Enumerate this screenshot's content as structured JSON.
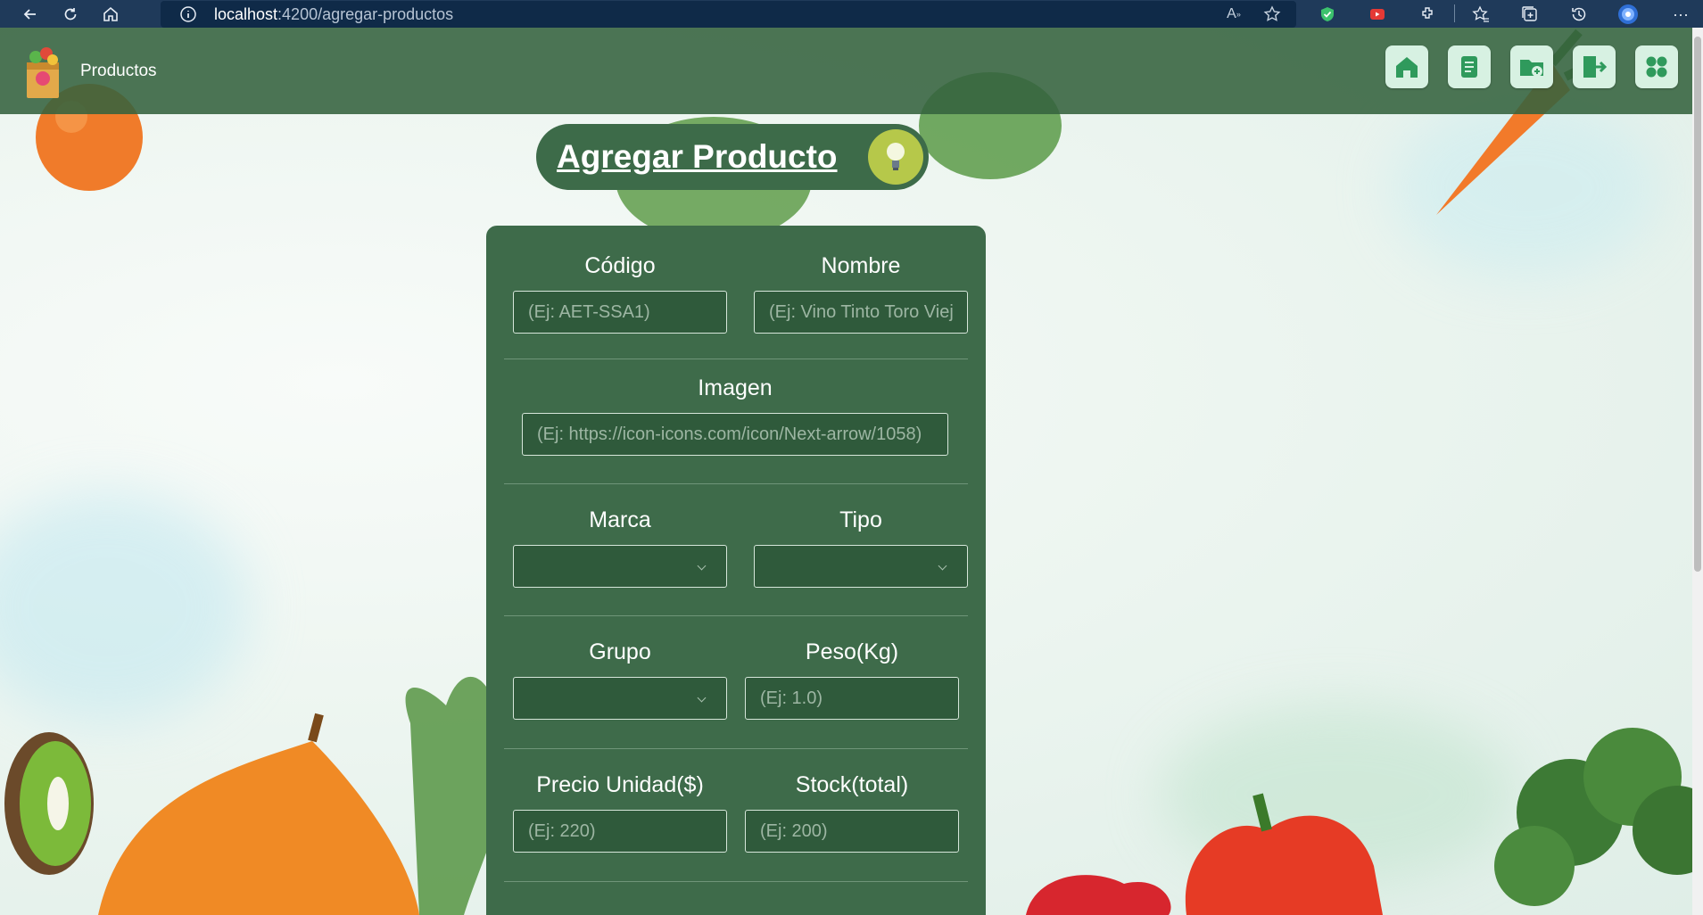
{
  "browser": {
    "url_host": "localhost",
    "url_path": ":4200/agregar-productos"
  },
  "header": {
    "brand": "Productos",
    "icons": [
      "home-icon",
      "document-icon",
      "add-folder-icon",
      "export-icon",
      "apps-icon"
    ]
  },
  "title": "Agregar Producto",
  "form": {
    "codigo": {
      "label": "Código",
      "placeholder": "(Ej: AET-SSA1)"
    },
    "nombre": {
      "label": "Nombre",
      "placeholder": "(Ej: Vino Tinto Toro Viej"
    },
    "imagen": {
      "label": "Imagen",
      "placeholder": "(Ej: https://icon-icons.com/icon/Next-arrow/1058)"
    },
    "marca": {
      "label": "Marca",
      "value": ""
    },
    "tipo": {
      "label": "Tipo",
      "value": ""
    },
    "grupo": {
      "label": "Grupo",
      "value": ""
    },
    "peso": {
      "label": "Peso(Kg)",
      "placeholder": "(Ej: 1.0)"
    },
    "precio": {
      "label": "Precio Unidad($)",
      "placeholder": "(Ej: 220)"
    },
    "stock": {
      "label": "Stock(total)",
      "placeholder": "(Ej: 200)"
    }
  },
  "colors": {
    "header_green": "#34623e",
    "card_green": "#3e6b4a",
    "input_green": "#2f5a3b"
  }
}
